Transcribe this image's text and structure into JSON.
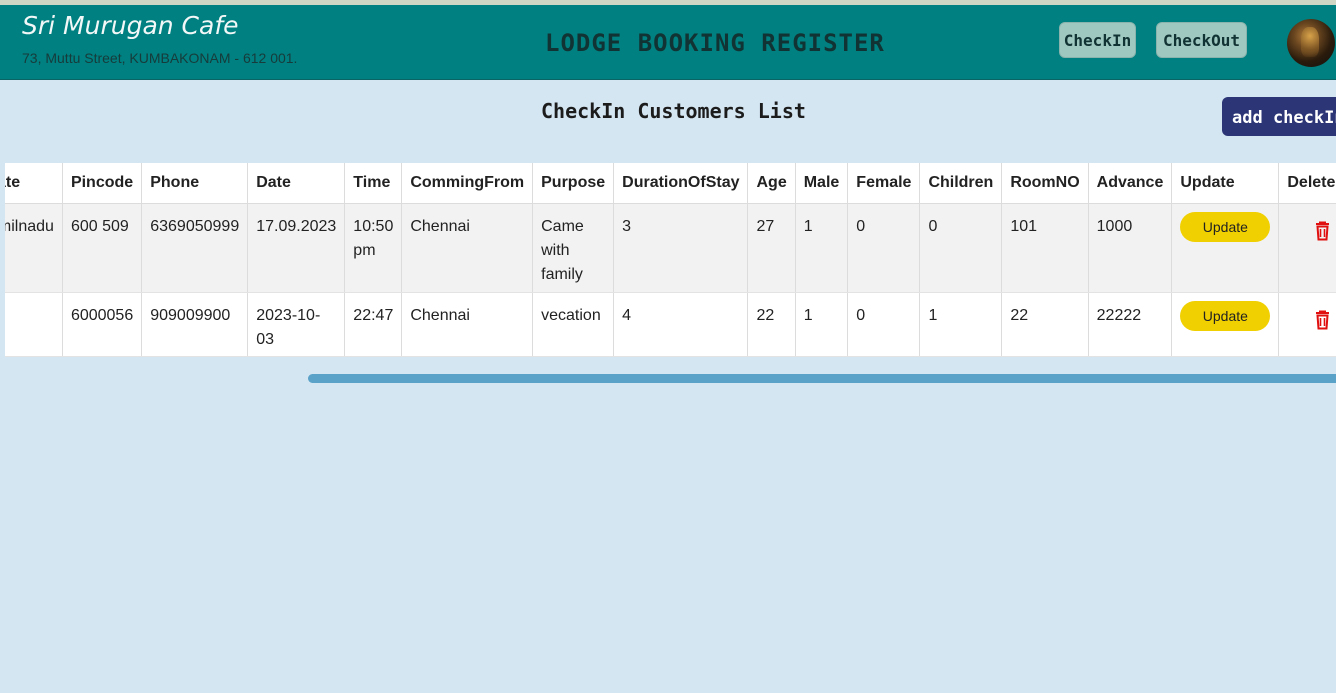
{
  "header": {
    "cafe_name": "Sri Murugan Cafe",
    "address": "73, Muttu Street, KUMBAKONAM - 612 001.",
    "title": "LODGE BOOKING REGISTER",
    "checkin_label": "CheckIn",
    "checkout_label": "CheckOut",
    "avatar_icon": "user-avatar"
  },
  "main": {
    "list_title": "CheckIn Customers List",
    "add_button_label": "add checkIn"
  },
  "table": {
    "columns": [
      "State",
      "Pincode",
      "Phone",
      "Date",
      "Time",
      "CommingFrom",
      "Purpose",
      "DurationOfStay",
      "Age",
      "Male",
      "Female",
      "Children",
      "RoomNO",
      "Advance",
      "Update",
      "Delete"
    ],
    "rows": [
      [
        "Tamilnadu",
        "600 509",
        "6369050999",
        "17.09.2023",
        "10:50 pm",
        "Chennai",
        "Came with family",
        "3",
        "27",
        "1",
        "0",
        "0",
        "101",
        "1000"
      ],
      [
        "",
        "6000056",
        "909009900",
        "2023-10-03",
        "22:47",
        "Chennai",
        "vecation",
        "4",
        "22",
        "1",
        "0",
        "1",
        "22",
        "22222"
      ]
    ],
    "update_label": "Update",
    "delete_icon": "trash-icon",
    "colors": {
      "update_button": "#f0d000",
      "delete_icon": "#e01010"
    }
  },
  "colors": {
    "header_bg": "#008080",
    "page_bg": "#d4e6f2",
    "add_button": "#2c3576",
    "scrollbar": "#5ba2c8"
  }
}
